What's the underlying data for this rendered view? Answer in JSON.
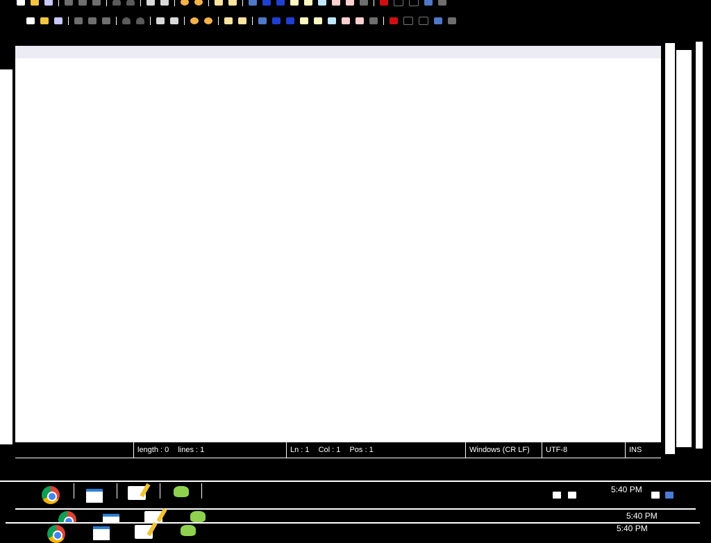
{
  "statusbar": {
    "length": "length : 0",
    "lines": "lines : 1",
    "ln": "Ln : 1",
    "col": "Col : 1",
    "pos": "Pos : 1",
    "eol": "Windows (CR LF)",
    "encoding": "UTF-8",
    "mode": "INS"
  },
  "taskbar": {
    "time_main": "5:40 PM",
    "time_echo_1": "5:40 PM",
    "time_echo_2": "5:40 PM"
  },
  "toolbar_icons": [
    "new-file-icon",
    "open-file-icon",
    "save-icon",
    "close-icon",
    "print-icon",
    "cut-icon",
    "copy-icon",
    "paste-icon",
    "undo-icon",
    "redo-icon",
    "find-icon",
    "replace-icon",
    "zoom-in-icon",
    "zoom-out-icon",
    "sync-vertical-icon",
    "sync-horizontal-icon",
    "word-wrap-icon",
    "all-characters-icon",
    "indent-guide-icon",
    "language-icon",
    "doc-map-icon",
    "function-list-icon",
    "folder-workspace-icon",
    "monitoring-icon",
    "record-macro-icon",
    "stop-macro-icon",
    "play-macro-icon",
    "run-macro-multiple-icon",
    "save-macro-icon"
  ]
}
